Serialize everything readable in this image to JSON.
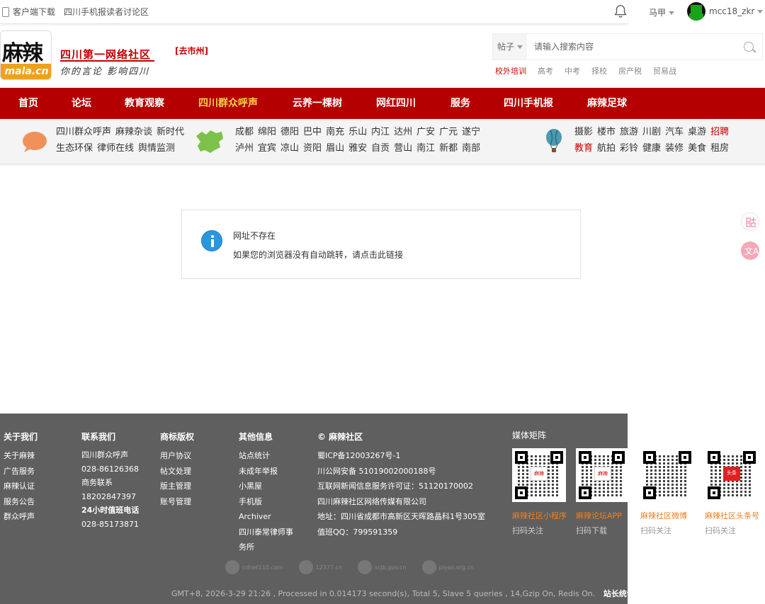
{
  "topbar": {
    "client_download": "客户端下载",
    "forum_link": "四川手机报读者讨论区",
    "city": "马甲",
    "username": "mcc18_zkr"
  },
  "header": {
    "logo_cn": "麻辣",
    "logo_en": "mala.cn",
    "slogan_main": "四川第一网络社区",
    "slogan_sub": "你的言论 影响四川",
    "goto_city": "[去市州]"
  },
  "search": {
    "type": "帖子",
    "placeholder": "请输入搜索内容",
    "hotwords": [
      "校外培训",
      "高考",
      "中考",
      "择校",
      "房产税",
      "贸易战"
    ]
  },
  "nav": {
    "items": [
      "首页",
      "论坛",
      "教育观察",
      "四川群众呼声",
      "云养一棵树",
      "网红四川",
      "服务",
      "四川手机报",
      "麻辣足球"
    ],
    "active_index": 3,
    "active_color": "#ffd24a",
    "bg_color": "#b50000"
  },
  "subnav": {
    "group1": {
      "row1": [
        "四川群众呼声",
        "麻辣杂谈",
        "新时代"
      ],
      "row2": [
        "生态环保",
        "律师在线",
        "舆情监测"
      ]
    },
    "group2": {
      "row1": [
        "成都",
        "绵阳",
        "德阳",
        "巴中",
        "南充",
        "乐山",
        "内江",
        "达州",
        "广安",
        "广元",
        "遂宁"
      ],
      "row2": [
        "泸州",
        "宜宾",
        "凉山",
        "资阳",
        "眉山",
        "雅安",
        "自贡",
        "营山",
        "南江",
        "新都",
        "南部"
      ]
    },
    "group3": {
      "row1": [
        "摄影",
        "楼市",
        "旅游",
        "川剧",
        "汽车",
        "桌游",
        "招聘"
      ],
      "row2": [
        "教育",
        "航拍",
        "彩铃",
        "健康",
        "装修",
        "美食",
        "租房"
      ],
      "highlight_color": "#c00000"
    }
  },
  "message": {
    "title": "网址不存在",
    "body": "如果您的浏览器没有自动跳转，请点击此链接"
  },
  "footer": {
    "about": {
      "title": "关于我们",
      "items": [
        "关于麻辣",
        "广告服务",
        "麻辣认证",
        "服务公告",
        "群众呼声"
      ]
    },
    "contact": {
      "title": "联系我们",
      "items": [
        "四川群众呼声",
        "028-86126368",
        "商务联系",
        "18202847397",
        "24小时值班电话",
        "028-85173871"
      ]
    },
    "trademark": {
      "title": "商标版权",
      "items": [
        "用户协议",
        "帖文处理",
        "版主管理",
        "账号管理"
      ]
    },
    "other": {
      "title": "其他信息",
      "items": [
        "站点统计",
        "未成年举报",
        "小黑屋",
        "手机版",
        "Archiver",
        "四川泰常律师事",
        "务所"
      ]
    },
    "company": {
      "title": "© 麻辣社区",
      "items": [
        "蜀ICP备12003267号-1",
        "川公网安备 51019002000188号",
        "互联网新闻信息服务许可证：51120170002",
        "四川麻辣社区网络传媒有限公司",
        "地址：四川省成都市高新区天晖路晶科1号305室",
        "值班QQ：799591359"
      ]
    },
    "media": {
      "title": "媒体矩阵",
      "qrs": [
        {
          "label": "麻辣社区小程序",
          "sub": "扫码关注"
        },
        {
          "label": "麻辣论坛APP",
          "sub": "扫码下载"
        },
        {
          "label": "麻辣社区微博",
          "sub": "扫码关注"
        },
        {
          "label": "麻辣社区头条号",
          "sub": "扫码关注"
        }
      ]
    },
    "bottom_text": "GMT+8, 2026-3-29 21:26 , Processed in 0.014173 second(s), Total 5, Slave 5 queries , 14,Gzip On, Redis On.",
    "bottom_link": "站长统计"
  }
}
